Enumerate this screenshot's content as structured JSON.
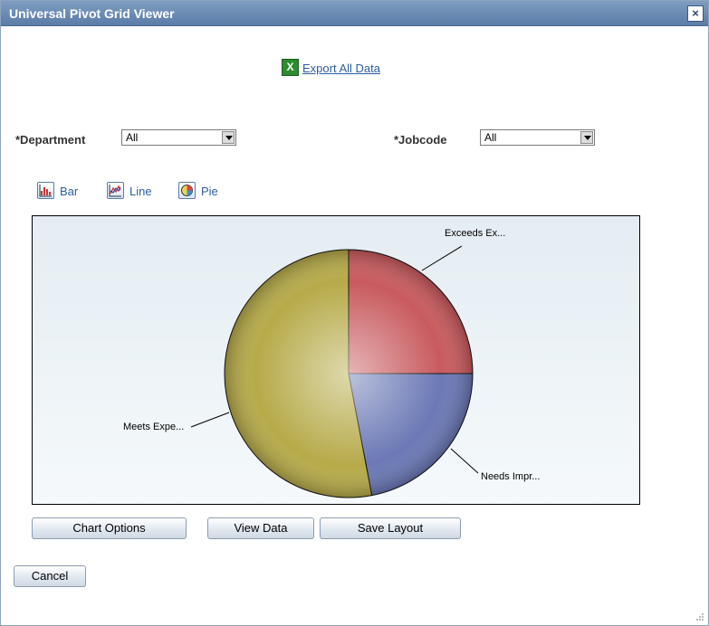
{
  "window": {
    "title": "Universal Pivot Grid Viewer",
    "close_glyph": "×"
  },
  "export": {
    "label": "Export All Data",
    "icon": "excel-icon"
  },
  "filters": [
    {
      "label": "*Department",
      "value": "All"
    },
    {
      "label": "*Jobcode",
      "value": "All"
    }
  ],
  "chart_types": [
    {
      "label": "Bar",
      "icon": "bar-chart-icon"
    },
    {
      "label": "Line",
      "icon": "line-chart-icon"
    },
    {
      "label": "Pie",
      "icon": "pie-chart-icon"
    }
  ],
  "chart_data": {
    "type": "pie",
    "slices": [
      {
        "label": "Exceeds Ex...",
        "value": 25,
        "color": "#c85a5e"
      },
      {
        "label": "Needs Impr...",
        "value": 22,
        "color": "#6a78b5"
      },
      {
        "label": "Meets Expe...",
        "value": 53,
        "color": "#b6aa49"
      }
    ],
    "title": "",
    "legend": "none"
  },
  "buttons": {
    "chart_options": "Chart Options",
    "view_data": "View Data",
    "save_layout": "Save Layout",
    "cancel": "Cancel"
  }
}
